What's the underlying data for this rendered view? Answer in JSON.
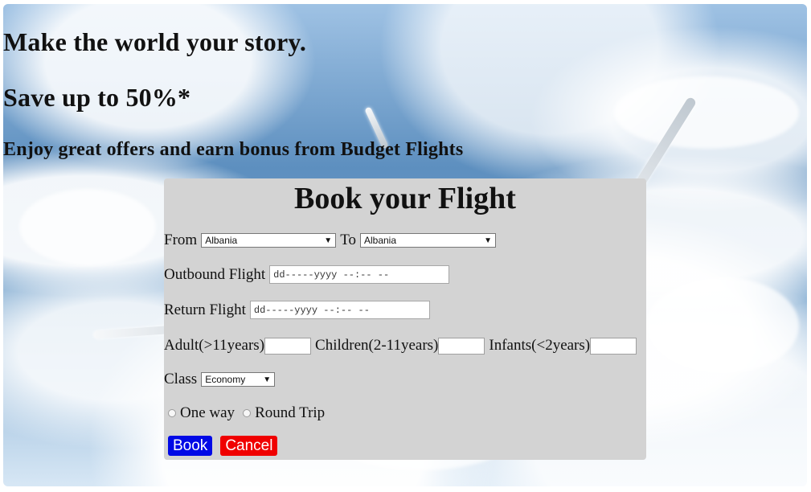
{
  "hero": {
    "headline": "Make the world your story.",
    "offer": "Save up to 50%*",
    "subtitle": "Enjoy great offers and earn bonus from Budget Flights"
  },
  "booking": {
    "title": "Book your Flight",
    "from_label": "From",
    "from_value": "Albania",
    "to_label": "To",
    "to_value": "Albania",
    "outbound_label": "Outbound Flight",
    "outbound_placeholder": "dd-----yyyy --:-- --",
    "return_label": "Return Flight",
    "return_placeholder": "dd-----yyyy --:-- --",
    "adult_label": "Adult(>11years)",
    "adult_value": "",
    "children_label": "Children(2-11years)",
    "children_value": "",
    "infants_label": "Infants(<2years)",
    "infants_value": "",
    "class_label": "Class",
    "class_value": "Economy",
    "trip_types": [
      "One way",
      "Round Trip"
    ],
    "book_button": "Book",
    "cancel_button": "Cancel"
  },
  "colors": {
    "panel": "#d3d3d3",
    "book": "#0009e6",
    "cancel": "#f00000"
  }
}
